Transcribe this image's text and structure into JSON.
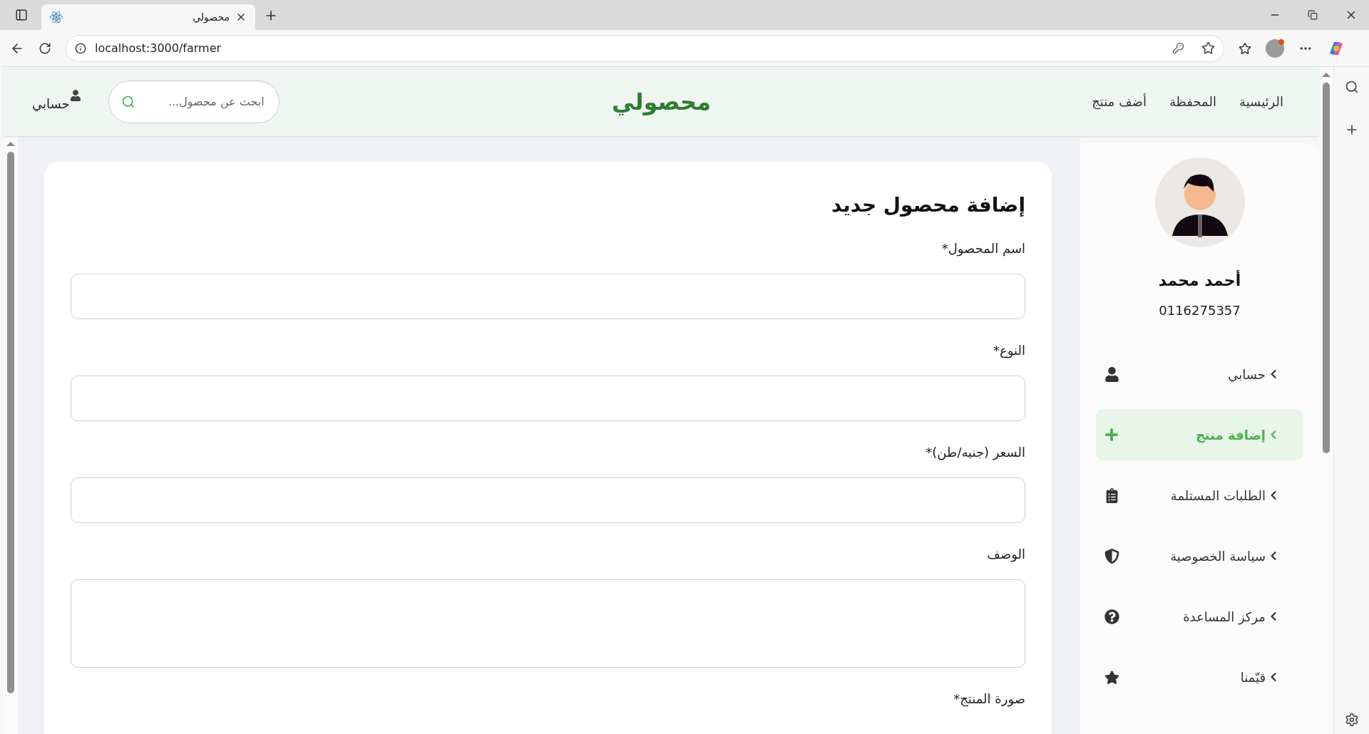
{
  "browser": {
    "tab_title": "محصولي",
    "url": "localhost:3000/farmer"
  },
  "header": {
    "nav": [
      {
        "label": "الرئيسية"
      },
      {
        "label": "المحفظة"
      },
      {
        "label": "أضف منتج"
      }
    ],
    "logo": "محصولي",
    "search": {
      "placeholder": "ابحث عن محصول..."
    },
    "account": "حسابي"
  },
  "form": {
    "title": "إضافة محصول جديد",
    "fields": [
      {
        "label": "اسم المحصول*",
        "kind": "input"
      },
      {
        "label": "النوع*",
        "kind": "input"
      },
      {
        "label": "السعر (جنيه/طن)*",
        "kind": "input"
      },
      {
        "label": "الوصف",
        "kind": "textarea"
      },
      {
        "label": "صورة المنتج*",
        "kind": "label"
      }
    ]
  },
  "profile": {
    "name": "أحمد محمد",
    "phone": "0116275357"
  },
  "menu": [
    {
      "label": "حسابي",
      "selected": false
    },
    {
      "label": "إضافة منتج",
      "selected": true
    },
    {
      "label": "الطلبات المستلمة",
      "selected": false
    },
    {
      "label": "سياسة الخصوصية",
      "selected": false
    },
    {
      "label": "مركز المساعدة",
      "selected": false
    },
    {
      "label": "قيّمنا",
      "selected": false
    }
  ]
}
